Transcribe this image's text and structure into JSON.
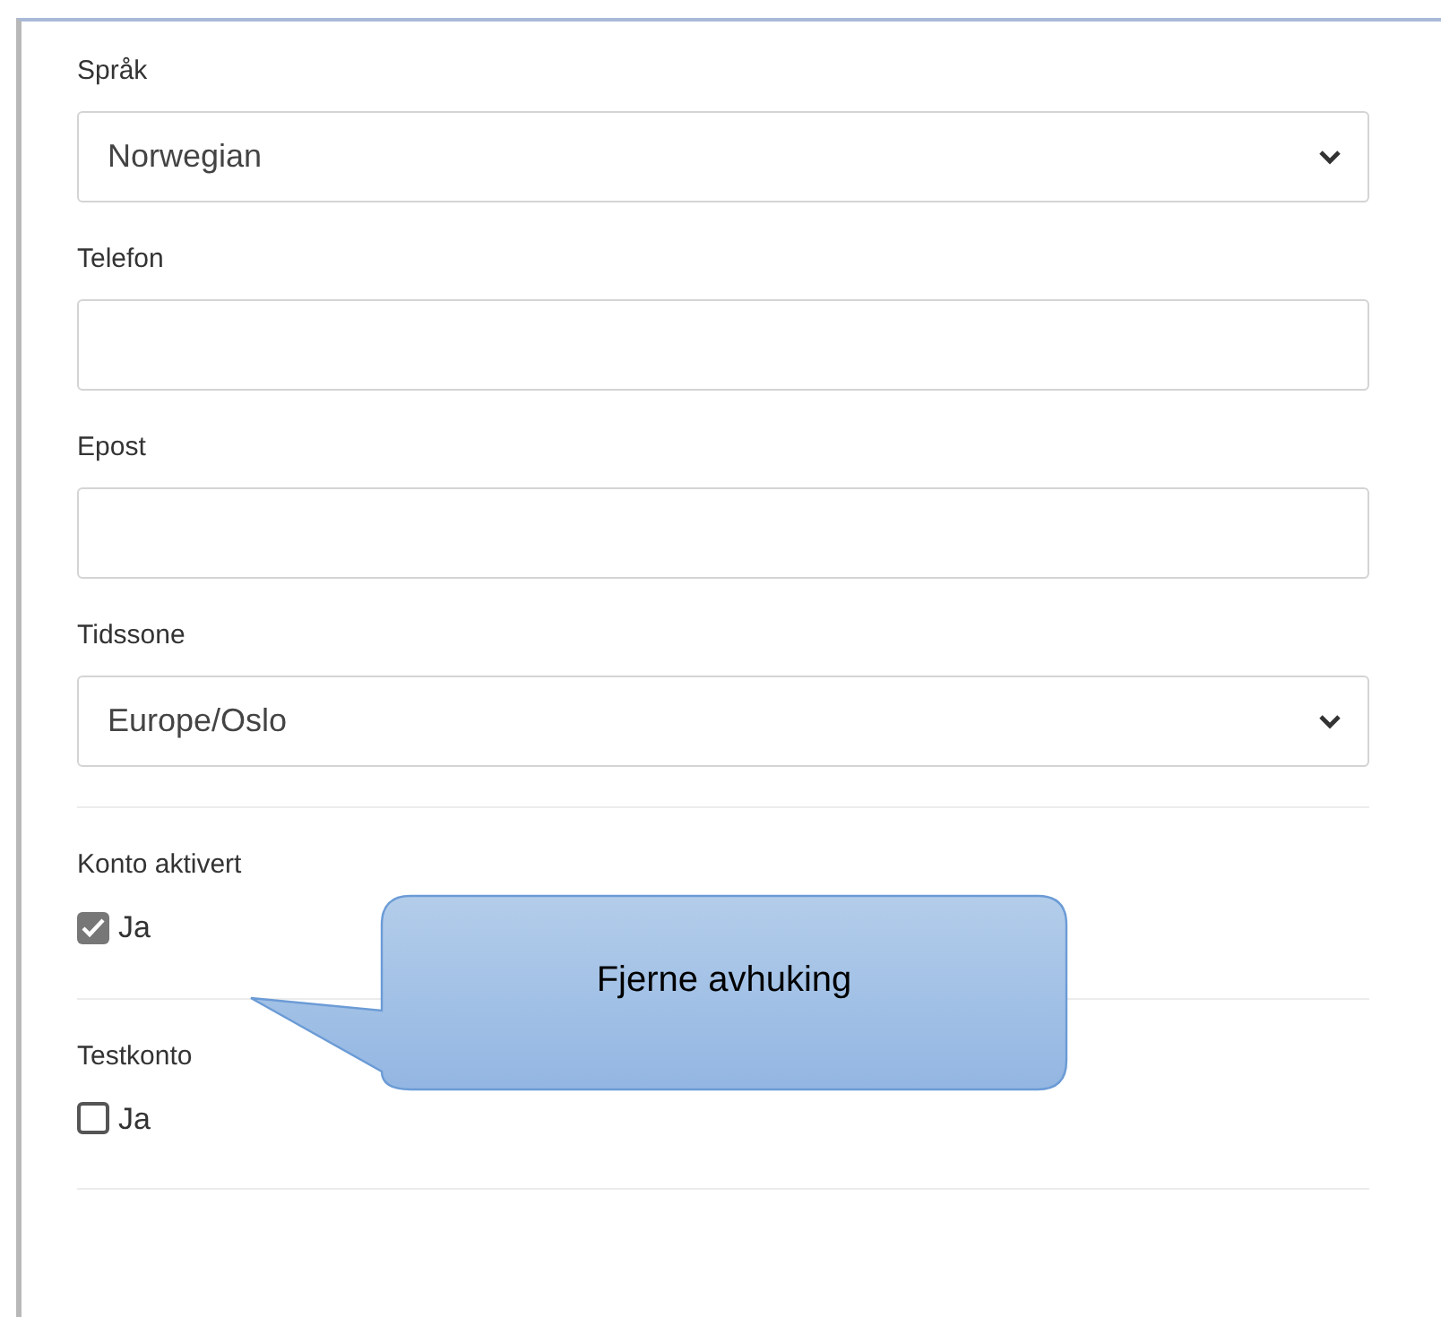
{
  "fields": [
    {
      "kind": "select",
      "label": "Språk",
      "value": "Norwegian"
    },
    {
      "kind": "text",
      "label": "Telefon"
    },
    {
      "kind": "text",
      "label": "Epost"
    },
    {
      "kind": "select",
      "label": "Tidssone",
      "value": "Europe/Oslo"
    },
    {
      "kind": "checkbox",
      "label": "Konto aktivert",
      "option": "Ja",
      "checked": true
    },
    {
      "kind": "checkbox",
      "label": "Testkonto",
      "option": "Ja",
      "checked": false
    }
  ],
  "callout": {
    "text": "Fjerne avhuking"
  }
}
